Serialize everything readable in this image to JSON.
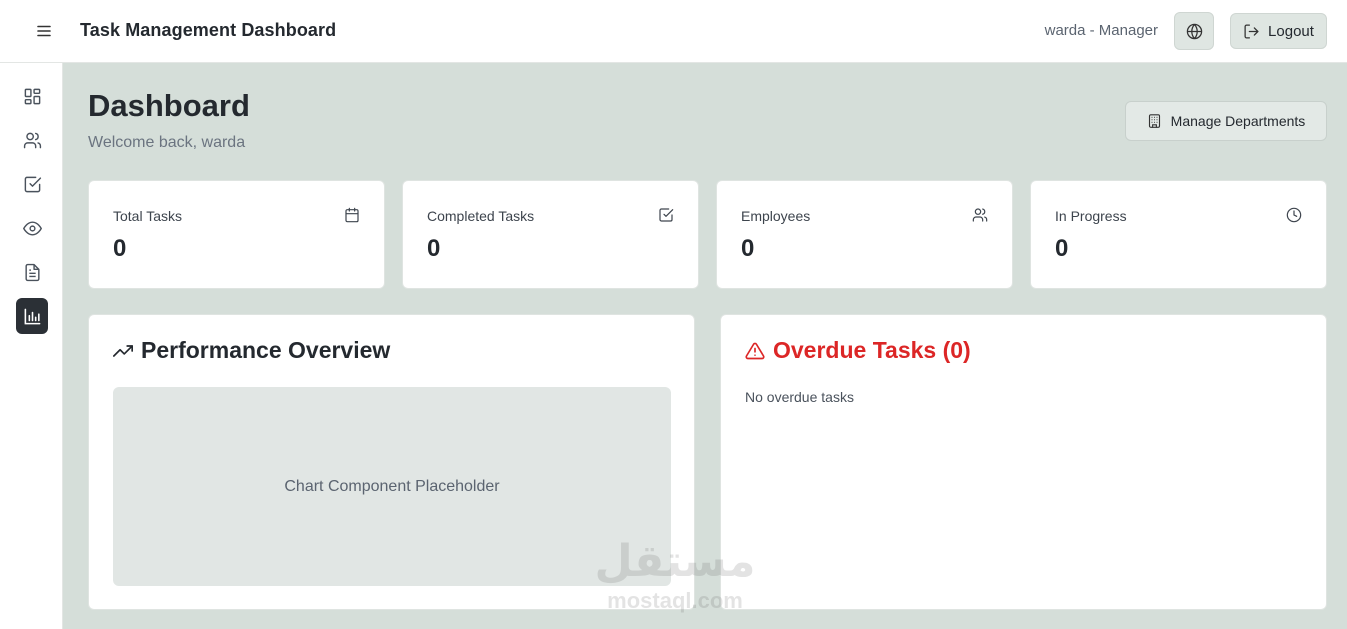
{
  "header": {
    "title": "Task Management Dashboard",
    "user_label": "warda - Manager",
    "logout_label": "Logout"
  },
  "sidebar": {
    "items": [
      {
        "name": "dashboard",
        "icon": "grid-icon"
      },
      {
        "name": "employees",
        "icon": "users-icon"
      },
      {
        "name": "tasks",
        "icon": "check-square-icon"
      },
      {
        "name": "review",
        "icon": "eye-icon"
      },
      {
        "name": "reports",
        "icon": "file-text-icon"
      },
      {
        "name": "analytics",
        "icon": "bar-chart-icon",
        "active": true
      }
    ]
  },
  "main": {
    "title": "Dashboard",
    "subtitle": "Welcome back, warda",
    "manage_departments_label": "Manage Departments",
    "stats": [
      {
        "label": "Total Tasks",
        "value": "0",
        "icon": "calendar-icon"
      },
      {
        "label": "Completed Tasks",
        "value": "0",
        "icon": "check-square-icon"
      },
      {
        "label": "Employees",
        "value": "0",
        "icon": "users-icon"
      },
      {
        "label": "In Progress",
        "value": "0",
        "icon": "clock-icon"
      }
    ],
    "performance": {
      "title": "Performance Overview",
      "placeholder": "Chart Component Placeholder"
    },
    "overdue": {
      "title": "Overdue Tasks (0)",
      "empty_text": "No overdue tasks"
    }
  },
  "watermark": {
    "arabic": "مستقل",
    "latin": "mostaql.com"
  },
  "colors": {
    "background": "#d5ded9",
    "card": "#ffffff",
    "danger": "#dc2626",
    "sidebar_active": "#2b3036"
  }
}
